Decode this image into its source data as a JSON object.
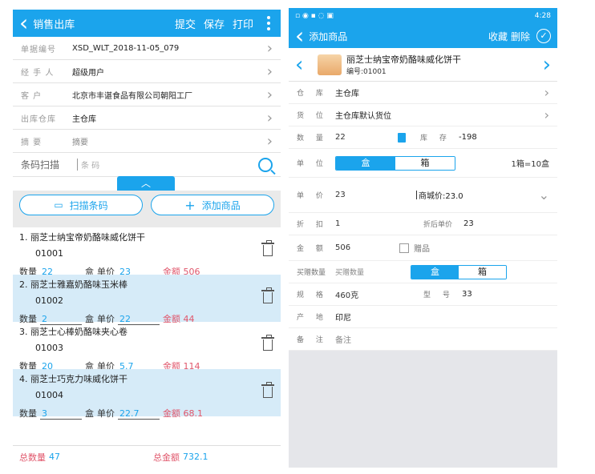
{
  "left": {
    "header": {
      "title": "销售出库",
      "actions": [
        "提交",
        "保存",
        "打印"
      ]
    },
    "fields": [
      {
        "label": "单据编号",
        "value": "XSD_WLT_2018-11-05_079"
      },
      {
        "label": "经 手 人",
        "value": "超级用户"
      },
      {
        "label": "客 户",
        "value": "北京市丰谌食品有限公司朝阳工厂"
      },
      {
        "label": "出库仓库",
        "value": "主仓库"
      },
      {
        "label": "摘 要",
        "value": "摘要"
      }
    ],
    "scan": {
      "label": "条码扫描",
      "placeholder": "条 码"
    },
    "buttons": {
      "scan_barcode": "扫描条码",
      "add_product": "添加商品"
    },
    "items": [
      {
        "name": "1.  丽芝士纳宝帝奶酪味威化饼干",
        "code": "01001",
        "qty_label": "数量",
        "qty": "22",
        "unit": "盒",
        "price_label": "单价",
        "price": "23",
        "amount": "金额 506"
      },
      {
        "name": "2.  丽芝士雅嘉奶酪味玉米棒",
        "code": "01002",
        "qty_label": "数量",
        "qty": "2",
        "unit": "盒",
        "price_label": "单价",
        "price": "22",
        "amount": "金额 44"
      },
      {
        "name": "3.  丽芝士心棒奶酪味夹心卷",
        "code": "01003",
        "qty_label": "数量",
        "qty": "20",
        "unit": "盒",
        "price_label": "单价",
        "price": "5.7",
        "amount": "金额 114"
      },
      {
        "name": "4.  丽芝士巧克力味威化饼干",
        "code": "01004",
        "qty_label": "数量",
        "qty": "3",
        "unit": "盒",
        "price_label": "单价",
        "price": "22.7",
        "amount": "金额 68.1"
      }
    ],
    "footer": {
      "total_qty_label": "总数量",
      "total_qty": "47",
      "total_amount_label": "总金额",
      "total_amount": "732.1"
    }
  },
  "right": {
    "status": {
      "time": "4:28"
    },
    "header": {
      "title": "添加商品",
      "actions": [
        "收藏",
        "删除"
      ]
    },
    "product": {
      "name": "丽芝士纳宝帝奶酪味威化饼干",
      "code": "编号:01001"
    },
    "warehouse": {
      "label": "仓 库",
      "value": "主仓库"
    },
    "location": {
      "label": "货 位",
      "value": "主仓库默认货位"
    },
    "quantity": {
      "label": "数 量",
      "value": "22",
      "stock_label": "库 存",
      "stock": "-198"
    },
    "unit": {
      "label": "单 位",
      "options": [
        "盒",
        "箱"
      ],
      "conversion": "1箱=10盒"
    },
    "price": {
      "label": "单 价",
      "value": "23",
      "mall_price": "商城价:23.0"
    },
    "discount": {
      "label": "折 扣",
      "value": "1",
      "after_label": "折后单价",
      "after": "23"
    },
    "amount": {
      "label": "金 额",
      "value": "506",
      "gift": "赠品"
    },
    "gift_qty": {
      "label": "买赠数量",
      "placeholder": "买赠数量",
      "options": [
        "盒",
        "箱"
      ]
    },
    "spec": {
      "label": "规 格",
      "value": "460克",
      "model_label": "型 号",
      "model": "33"
    },
    "origin": {
      "label": "产 地",
      "value": "印尼"
    },
    "note": {
      "label": "备 注",
      "value": "备注"
    }
  }
}
